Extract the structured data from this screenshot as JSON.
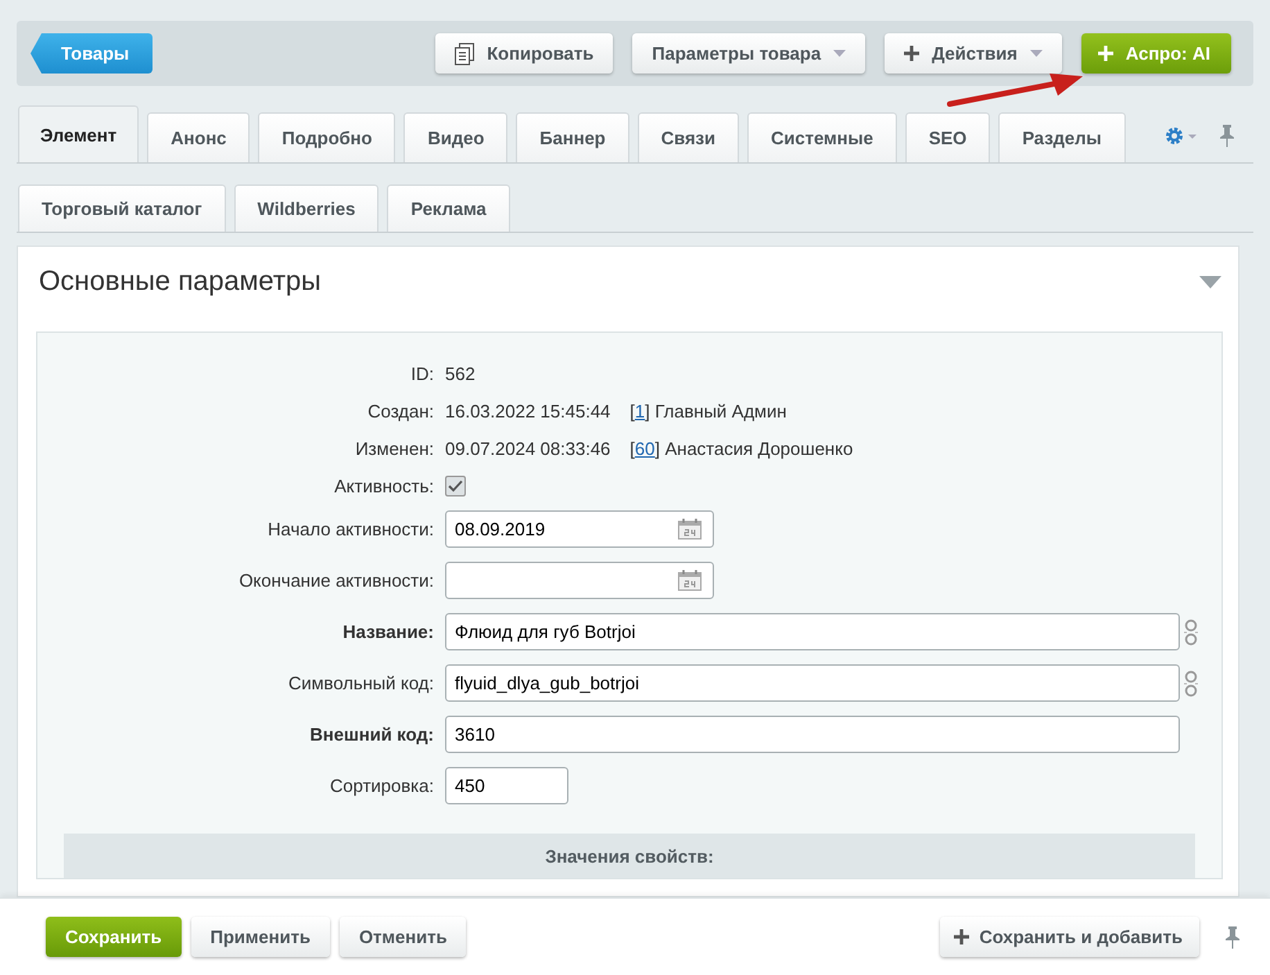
{
  "toolbar": {
    "back": "Товары",
    "buttons": [
      {
        "label": "Копировать",
        "kind": "copy"
      },
      {
        "label": "Параметры товара",
        "kind": "dropdown"
      },
      {
        "label": "Действия",
        "kind": "plus-dropdown"
      },
      {
        "label": "Аспро: AI",
        "kind": "accent"
      }
    ]
  },
  "tabs": [
    {
      "label": "Элемент",
      "selected": true
    },
    {
      "label": "Анонс",
      "selected": false
    },
    {
      "label": "Подробно",
      "selected": false
    },
    {
      "label": "Видео",
      "selected": false
    },
    {
      "label": "Баннер",
      "selected": false
    },
    {
      "label": "Связи",
      "selected": false
    },
    {
      "label": "Системные",
      "selected": false
    },
    {
      "label": "SEO",
      "selected": false
    },
    {
      "label": "Разделы",
      "selected": false
    }
  ],
  "subtabs": [
    {
      "label": "Торговый каталог",
      "selected": false
    },
    {
      "label": "Wildberries",
      "selected": false
    },
    {
      "label": "Реклама",
      "selected": false
    }
  ],
  "section": {
    "title": "Основные параметры",
    "expanded": true,
    "fields": [
      {
        "kind": "info",
        "label": "ID:",
        "value": "562"
      },
      {
        "kind": "info",
        "label": "Создан:",
        "value": "16.03.2022 15:45:44",
        "author": {
          "before": "[",
          "id": "1",
          "after": "] Главный Админ"
        }
      },
      {
        "kind": "info",
        "label": "Изменен:",
        "value": "09.07.2024 08:33:46",
        "author": {
          "before": "[",
          "id": "60",
          "after": "] Анастасия Дорошенко"
        }
      },
      {
        "kind": "checkbox",
        "label": "Активность:",
        "checked": true
      },
      {
        "kind": "date",
        "label": "Начало активности:",
        "value": "08.09.2019"
      },
      {
        "kind": "date",
        "label": "Окончание активности:"
      },
      {
        "kind": "translit",
        "label": "Название:",
        "value": "Флюид для губ Botrjoi",
        "required": true
      },
      {
        "kind": "translit",
        "label": "Символьный код:",
        "value": "flyuid_dlya_gub_botrjoi",
        "required": false
      },
      {
        "kind": "text",
        "label": "Внешний код:",
        "value": "3610",
        "required": true
      },
      {
        "kind": "short",
        "label": "Сортировка:",
        "value": "450"
      }
    ],
    "subheading": "Значения свойств:"
  },
  "footer": {
    "buttons": [
      {
        "label": "Сохранить",
        "kind": "primary"
      },
      {
        "label": "Применить",
        "kind": "plain"
      },
      {
        "label": "Отменить",
        "kind": "plain"
      }
    ],
    "save_add": "Сохранить и добавить"
  }
}
